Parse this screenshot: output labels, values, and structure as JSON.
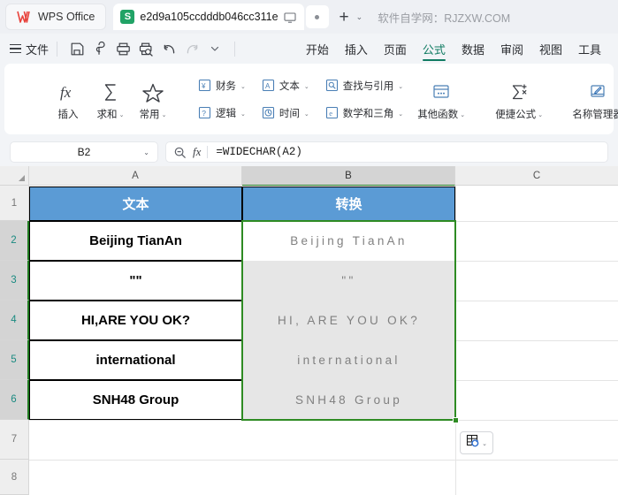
{
  "titlebar": {
    "app_tab_label": "WPS Office",
    "app_logo_icon": "wps-logo-icon",
    "doc_icon_letter": "S",
    "doc_tab_title": "e2d9a105ccdddb046cc311e",
    "monitor_icon": "monitor-icon",
    "dot_icon": "dot-icon",
    "new_tab_label": "+",
    "tab_list_caret": "⌄",
    "brand_text": "软件自学网：RJZXW.COM"
  },
  "menubar": {
    "file_label": "文件",
    "quick_icons": [
      "save-icon",
      "share-link-icon",
      "print-icon",
      "print-preview-icon",
      "undo-icon",
      "redo-icon",
      "customize-caret-icon"
    ],
    "tabs": [
      {
        "label": "开始",
        "active": false
      },
      {
        "label": "插入",
        "active": false
      },
      {
        "label": "页面",
        "active": false
      },
      {
        "label": "公式",
        "active": true
      },
      {
        "label": "数据",
        "active": false
      },
      {
        "label": "审阅",
        "active": false
      },
      {
        "label": "视图",
        "active": false
      },
      {
        "label": "工具",
        "active": false
      }
    ]
  },
  "ribbon": {
    "big_buttons": [
      {
        "label": "插入",
        "icon": "fx-icon",
        "caret": ""
      },
      {
        "label": "求和",
        "icon": "sigma-icon",
        "caret": "⌄"
      },
      {
        "label": "常用",
        "icon": "star-icon",
        "caret": "⌄"
      }
    ],
    "func_categories_row1": [
      {
        "label": "财务",
        "icon": "financial-icon",
        "caret": "⌄"
      },
      {
        "label": "文本",
        "icon": "text-icon",
        "caret": "⌄"
      },
      {
        "label": "查找与引用",
        "icon": "lookup-icon",
        "caret": "⌄"
      }
    ],
    "func_categories_row2": [
      {
        "label": "逻辑",
        "icon": "logic-icon",
        "caret": "⌄"
      },
      {
        "label": "时间",
        "icon": "time-icon",
        "caret": "⌄"
      },
      {
        "label": "数学和三角",
        "icon": "math-icon",
        "caret": "⌄"
      }
    ],
    "other_functions": {
      "label": "其他函数",
      "icon": "other-functions-icon",
      "caret": "⌄"
    },
    "convenient_formula": {
      "label": "便捷公式",
      "icon": "convenient-formula-icon",
      "caret": "⌄"
    },
    "name_manager": {
      "label": "名称管理器",
      "icon": "name-manager-icon"
    }
  },
  "formulabar": {
    "name_box_value": "B2",
    "name_box_caret": "⌄",
    "search_icon": "search-function-icon",
    "fx_label": "fx",
    "formula": "=WIDECHAR(A2)"
  },
  "sheet": {
    "column_headers": [
      {
        "label": "A",
        "active": false
      },
      {
        "label": "B",
        "active": true
      },
      {
        "label": "C",
        "active": false
      }
    ],
    "row_headers": [
      {
        "label": "1",
        "selected": false
      },
      {
        "label": "2",
        "selected": true
      },
      {
        "label": "3",
        "selected": true
      },
      {
        "label": "4",
        "selected": true
      },
      {
        "label": "5",
        "selected": true
      },
      {
        "label": "6",
        "selected": true
      },
      {
        "label": "7",
        "selected": false
      },
      {
        "label": "8",
        "selected": false
      }
    ],
    "header_row": {
      "a": "文本",
      "b": "转换"
    },
    "rows": [
      {
        "a": "Beijing TianAn",
        "b": "Beijing TianAn"
      },
      {
        "a": "\"\"",
        "b": "\"\""
      },
      {
        "a": "HI,ARE YOU OK?",
        "b": "HI, ARE YOU OK?"
      },
      {
        "a": "international",
        "b": "international"
      },
      {
        "a": "SNH48 Group",
        "b": "SNH48 Group"
      }
    ],
    "selection_range": "B2:B6",
    "paste_options_icon": "paste-options-icon",
    "paste_options_caret": "⌄"
  },
  "colors": {
    "accent": "#107b62",
    "header_fill": "#5b9bd5",
    "selection_border": "#2e8b23",
    "result_fill": "#e6e6e6"
  }
}
